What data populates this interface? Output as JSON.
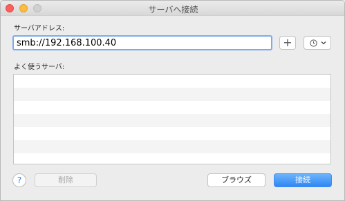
{
  "window": {
    "title": "サーバへ接続"
  },
  "address": {
    "label": "サーバアドレス:",
    "value": "smb://192.168.100.40"
  },
  "add_button": {
    "label": "+"
  },
  "history_button": {
    "icon": "clock-icon"
  },
  "favorites": {
    "label": "よく使うサーバ:",
    "items": []
  },
  "footer": {
    "help_label": "?",
    "delete_label": "削除",
    "browse_label": "ブラウズ",
    "connect_label": "接続"
  },
  "colors": {
    "accent": "#2f86f5",
    "close": "#fc605c",
    "minimize": "#fdbc40"
  }
}
